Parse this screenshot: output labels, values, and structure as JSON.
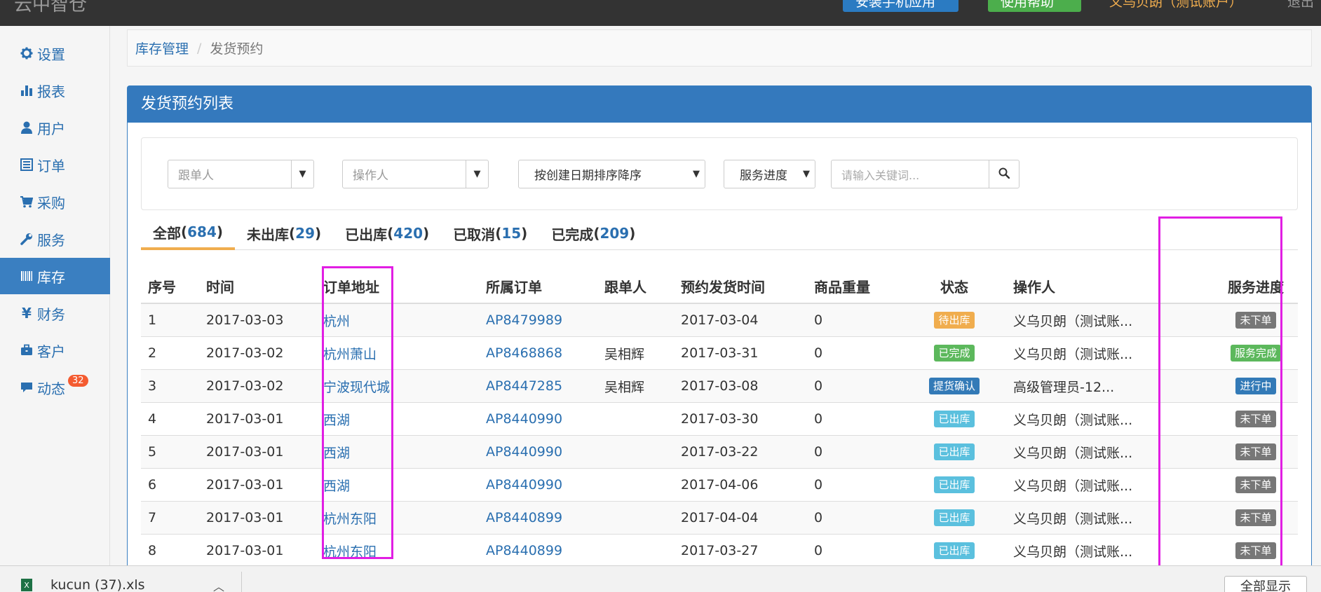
{
  "topbar": {
    "brand": "云中智仓",
    "btn_mobile": "安装手机应用",
    "btn_help": "使用帮助",
    "user": "义乌贝朗（测试账户）",
    "logout": "退出"
  },
  "sidebar": {
    "items": [
      {
        "label": "设置",
        "icon": "gear-icon"
      },
      {
        "label": "报表",
        "icon": "bar-chart-icon"
      },
      {
        "label": "用户",
        "icon": "user-icon"
      },
      {
        "label": "订单",
        "icon": "list-icon"
      },
      {
        "label": "采购",
        "icon": "cart-icon"
      },
      {
        "label": "服务",
        "icon": "wrench-icon"
      },
      {
        "label": "库存",
        "icon": "barcode-icon"
      },
      {
        "label": "财务",
        "icon": "yen-icon"
      },
      {
        "label": "客户",
        "icon": "briefcase-icon"
      },
      {
        "label": "动态",
        "icon": "comment-icon",
        "badge": "32"
      }
    ],
    "active": "库存"
  },
  "breadcrumb": {
    "parent": "库存管理",
    "separator": "/",
    "current": "发货预约"
  },
  "panel": {
    "title": "发货预约列表"
  },
  "filters": {
    "follower_placeholder": "跟单人",
    "operator_placeholder": "操作人",
    "sort_value": "按创建日期排序降序",
    "progress_value": "服务进度",
    "keyword_placeholder": "请输入关键词..."
  },
  "tabs": [
    {
      "label": "全部",
      "count": "684"
    },
    {
      "label": "未出库",
      "count": "29"
    },
    {
      "label": "已出库",
      "count": "420"
    },
    {
      "label": "已取消",
      "count": "15"
    },
    {
      "label": "已完成",
      "count": "209"
    }
  ],
  "table": {
    "headers": {
      "index": "序号",
      "time": "时间",
      "address": "订单地址",
      "order": "所属订单",
      "follower": "跟单人",
      "ship_time": "预约发货时间",
      "weight": "商品重量",
      "status": "状态",
      "operator": "操作人",
      "progress": "服务进度"
    },
    "rows": [
      {
        "index": "1",
        "time": "2017-03-03",
        "address": "杭州",
        "order": "AP8479989",
        "follower": "",
        "ship_time": "2017-03-04",
        "weight": "0",
        "status": "待出库",
        "status_style": "warning",
        "operator": "义乌贝朗（测试账...",
        "progress": "未下单",
        "progress_style": "default"
      },
      {
        "index": "2",
        "time": "2017-03-02",
        "address": "杭州萧山",
        "order": "AP8468868",
        "follower": "吴相辉",
        "ship_time": "2017-03-31",
        "weight": "0",
        "status": "已完成",
        "status_style": "success",
        "operator": "义乌贝朗（测试账...",
        "progress": "服务完成",
        "progress_style": "success"
      },
      {
        "index": "3",
        "time": "2017-03-02",
        "address": "宁波现代城",
        "order": "AP8447285",
        "follower": "吴相辉",
        "ship_time": "2017-03-08",
        "weight": "0",
        "status": "提货确认",
        "status_style": "primary",
        "operator": "高级管理员-12...",
        "progress": "进行中",
        "progress_style": "primary"
      },
      {
        "index": "4",
        "time": "2017-03-01",
        "address": "西湖",
        "order": "AP8440990",
        "follower": "",
        "ship_time": "2017-03-30",
        "weight": "0",
        "status": "已出库",
        "status_style": "info",
        "operator": "义乌贝朗（测试账...",
        "progress": "未下单",
        "progress_style": "default"
      },
      {
        "index": "5",
        "time": "2017-03-01",
        "address": "西湖",
        "order": "AP8440990",
        "follower": "",
        "ship_time": "2017-03-22",
        "weight": "0",
        "status": "已出库",
        "status_style": "info",
        "operator": "义乌贝朗（测试账...",
        "progress": "未下单",
        "progress_style": "default"
      },
      {
        "index": "6",
        "time": "2017-03-01",
        "address": "西湖",
        "order": "AP8440990",
        "follower": "",
        "ship_time": "2017-04-06",
        "weight": "0",
        "status": "已出库",
        "status_style": "info",
        "operator": "义乌贝朗（测试账...",
        "progress": "未下单",
        "progress_style": "default"
      },
      {
        "index": "7",
        "time": "2017-03-01",
        "address": "杭州东阳",
        "order": "AP8440899",
        "follower": "",
        "ship_time": "2017-04-04",
        "weight": "0",
        "status": "已出库",
        "status_style": "info",
        "operator": "义乌贝朗（测试账...",
        "progress": "未下单",
        "progress_style": "default"
      },
      {
        "index": "8",
        "time": "2017-03-01",
        "address": "杭州东阳",
        "order": "AP8440899",
        "follower": "",
        "ship_time": "2017-03-27",
        "weight": "0",
        "status": "已出库",
        "status_style": "info",
        "operator": "义乌贝朗（测试账...",
        "progress": "未下单",
        "progress_style": "default"
      }
    ]
  },
  "download_bar": {
    "file_name": "kucun (37).xls",
    "show_all": "全部显示"
  },
  "colors": {
    "primary": "#3479bd",
    "link": "#2a6fb0",
    "highlight": "#e11ee3",
    "tab_active": "#f0ad4e"
  }
}
